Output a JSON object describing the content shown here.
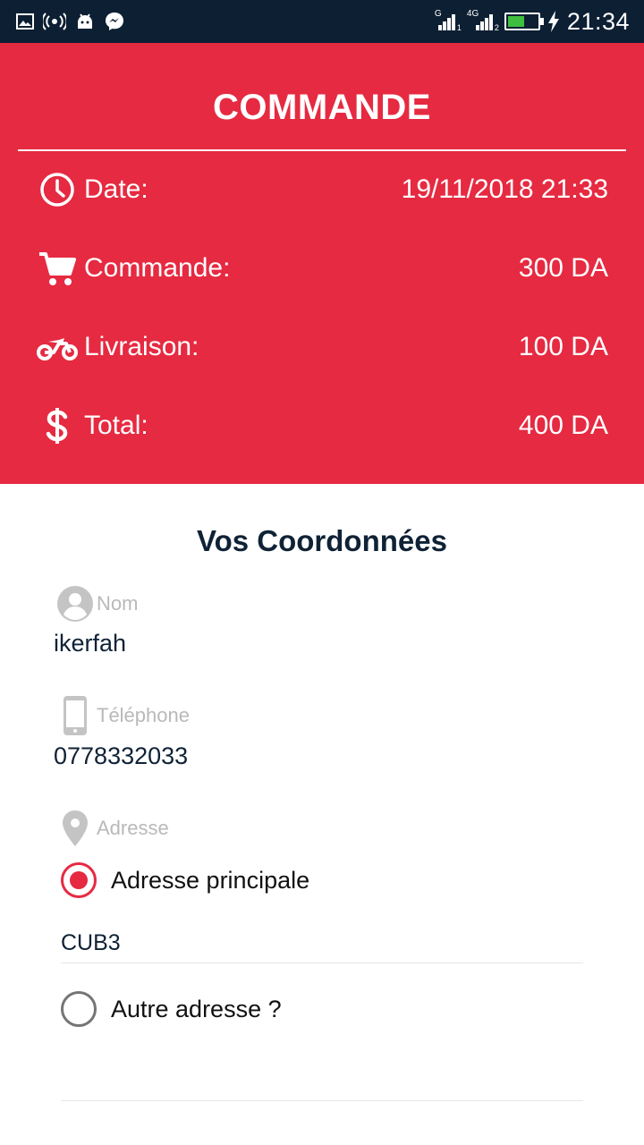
{
  "status_bar": {
    "time": "21:34",
    "sim1_label": "G",
    "sim1_sub": "1",
    "sim2_label": "4G",
    "sim2_sub": "2"
  },
  "order": {
    "title": "COMMANDE",
    "rows": [
      {
        "icon": "clock-icon",
        "label": "Date:",
        "value": "19/11/2018 21:33"
      },
      {
        "icon": "cart-icon",
        "label": "Commande:",
        "value": "300 DA"
      },
      {
        "icon": "motorbike-icon",
        "label": "Livraison:",
        "value": "100 DA"
      },
      {
        "icon": "dollar-icon",
        "label": "Total:",
        "value": "400 DA"
      }
    ]
  },
  "coordinates": {
    "title": "Vos Coordonnées",
    "name": {
      "label": "Nom",
      "value": "ikerfah"
    },
    "phone": {
      "label": "Téléphone",
      "value": "0778332033"
    },
    "address": {
      "label": "Adresse",
      "options": [
        {
          "label": "Adresse principale",
          "selected": true
        },
        {
          "label": "Autre adresse ?",
          "selected": false
        }
      ],
      "main_value": "CUB3"
    }
  },
  "colors": {
    "accent": "#e62a41",
    "status_bar": "#0d1f33",
    "text_dark": "#0f2236",
    "hint": "#b9b9b9"
  }
}
